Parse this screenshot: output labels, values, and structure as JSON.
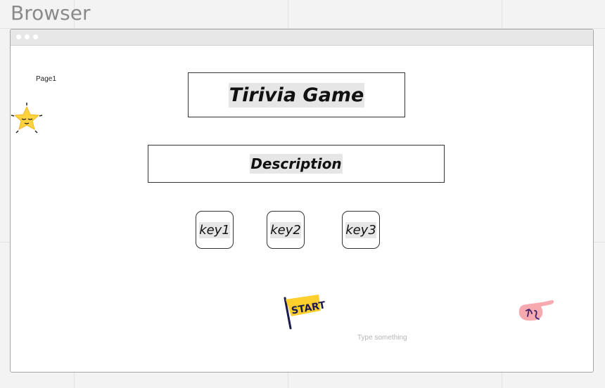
{
  "canvas": {
    "label": "Browser"
  },
  "browser": {
    "page_label": "Page1",
    "title": "Tirivia Game",
    "description": "Description",
    "keys": [
      "key1",
      "key2",
      "key3"
    ],
    "input_placeholder": "Type something"
  },
  "stickers": {
    "star": "star-face-icon",
    "start_flag": "START",
    "hand": "pointing-hand-icon"
  },
  "colors": {
    "canvas_bg": "#f3f3f3",
    "highlight": "#e6e6e6",
    "star": "#ffd23f",
    "flag": "#ffcf2e",
    "hand": "#f7a9b0"
  }
}
